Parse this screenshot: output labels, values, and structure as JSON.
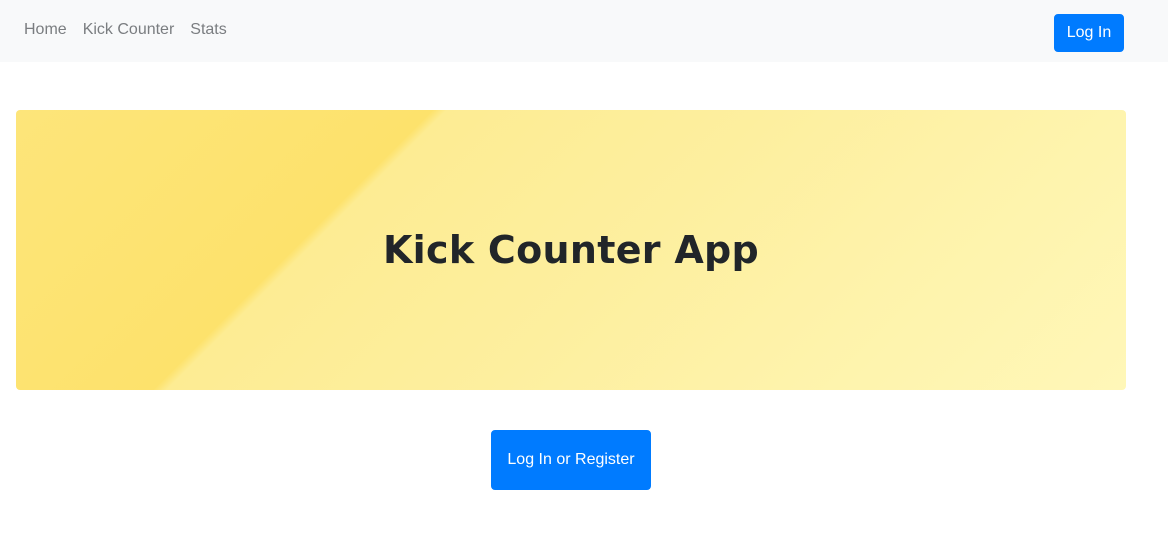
{
  "navbar": {
    "links": [
      {
        "label": "Home"
      },
      {
        "label": "Kick Counter"
      },
      {
        "label": "Stats"
      }
    ],
    "login_label": "Log In"
  },
  "hero": {
    "title": "Kick Counter App"
  },
  "cta": {
    "label": "Log In or Register"
  },
  "colors": {
    "primary": "#007bff",
    "navbar_bg": "#f8f9fa",
    "hero_yellow": "#fde26c",
    "title_text": "#212529",
    "nav_link": "#7a7d80"
  }
}
